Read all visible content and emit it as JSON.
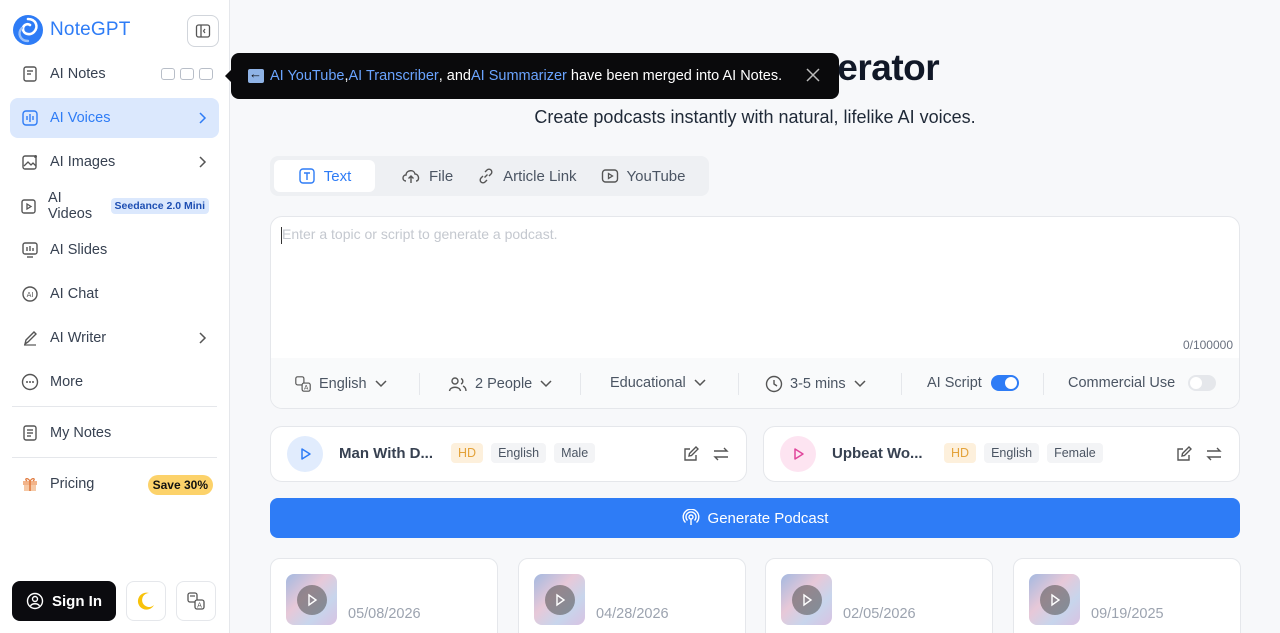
{
  "app": {
    "name": "NoteGPT"
  },
  "sidebar": {
    "items": [
      {
        "label": "AI Notes",
        "icon": "notes-icon"
      },
      {
        "label": "AI Voices",
        "icon": "voice-icon",
        "active": true
      },
      {
        "label": "AI Images",
        "icon": "image-icon"
      },
      {
        "label": "AI Videos",
        "icon": "video-icon",
        "badge": "Seedance 2.0 Mini"
      },
      {
        "label": "AI Slides",
        "icon": "slides-icon"
      },
      {
        "label": "AI Chat",
        "icon": "chat-icon"
      },
      {
        "label": "AI Writer",
        "icon": "pen-icon"
      },
      {
        "label": "More",
        "icon": "more-icon"
      }
    ],
    "my_notes": "My Notes",
    "pricing": "Pricing",
    "pricing_badge": "Save 30%",
    "sign_in": "Sign In"
  },
  "tooltip": {
    "link1": "AI YouTube",
    "sep1": ", ",
    "link2": "AI Transcriber",
    "sep2": ", and ",
    "link3": "AI Summarizer",
    "rest": " have been merged into AI Notes."
  },
  "main": {
    "title_visible": "erator",
    "subtitle": "Create podcasts instantly with natural, lifelike AI voices.",
    "tabs": [
      {
        "label": "Text",
        "active": true
      },
      {
        "label": "File"
      },
      {
        "label": "Article Link"
      },
      {
        "label": "YouTube"
      }
    ],
    "editor": {
      "placeholder": "Enter a topic or script to generate a podcast.",
      "count": "0/100000"
    },
    "options": {
      "language": "English",
      "people": "2 People",
      "style": "Educational",
      "duration": "3-5 mins",
      "ai_script": "AI Script",
      "ai_script_on": true,
      "commercial": "Commercial Use",
      "commercial_on": false
    },
    "voices": [
      {
        "name": "Man With D...",
        "tags": [
          "HD",
          "English",
          "Male"
        ],
        "accent": "#2e7cf6",
        "bg": "#e1ecfd"
      },
      {
        "name": "Upbeat Wo...",
        "tags": [
          "HD",
          "English",
          "Female"
        ],
        "accent": "#e0459b",
        "bg": "#fde4f1"
      }
    ],
    "generate_label": "Generate Podcast",
    "recent": [
      {
        "date": "05/08/2026"
      },
      {
        "date": "04/28/2026"
      },
      {
        "date": "02/05/2026"
      },
      {
        "date": "09/19/2025"
      }
    ]
  },
  "colors": {
    "accent": "#2e7cf6",
    "active_bg": "#dbe8fd",
    "badge_save": "#fcd26a"
  }
}
